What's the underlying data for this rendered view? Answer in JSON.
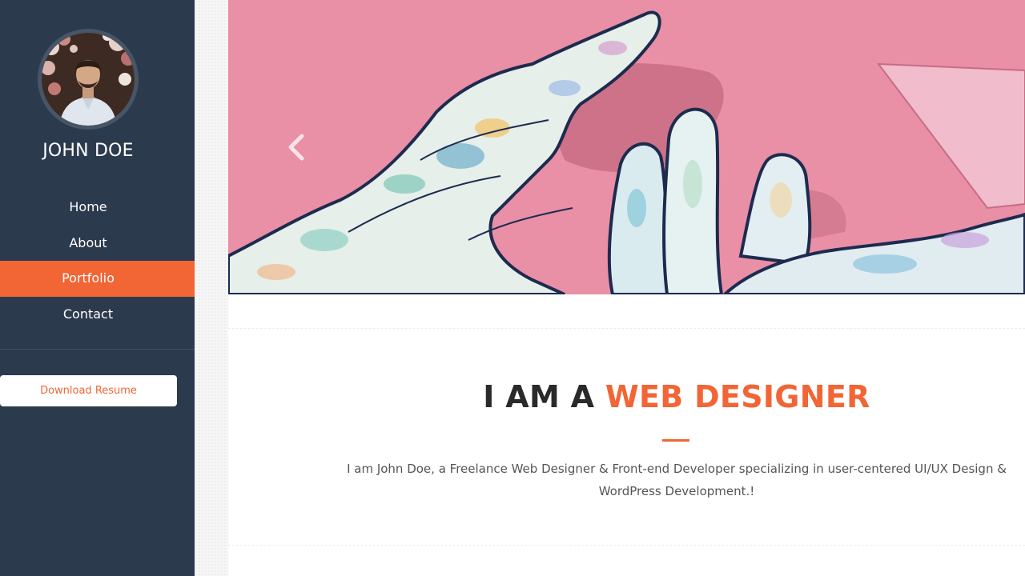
{
  "profile": {
    "name": "JOHN DOE",
    "avatar_icon": "profile-photo"
  },
  "nav": {
    "items": [
      {
        "label": "Home"
      },
      {
        "label": "About"
      },
      {
        "label": "Portfolio"
      },
      {
        "label": "Contact"
      }
    ],
    "active": "Portfolio"
  },
  "sidebar": {
    "download_label": "Download Resume"
  },
  "hero": {
    "prev_icon": "chevron-left-icon"
  },
  "intro": {
    "headline_prefix": "I AM A ",
    "headline_accent": "WEB DESIGNER",
    "body": "I am John Doe, a Freelance Web Designer & Front-end Developer specializing in user-centered UI/UX Design & WordPress Development.!"
  },
  "colors": {
    "sidebar_bg": "#2c3a4e",
    "accent": "#f26535",
    "hero_bg": "#e98fa6",
    "heading": "#2a2a2a"
  }
}
